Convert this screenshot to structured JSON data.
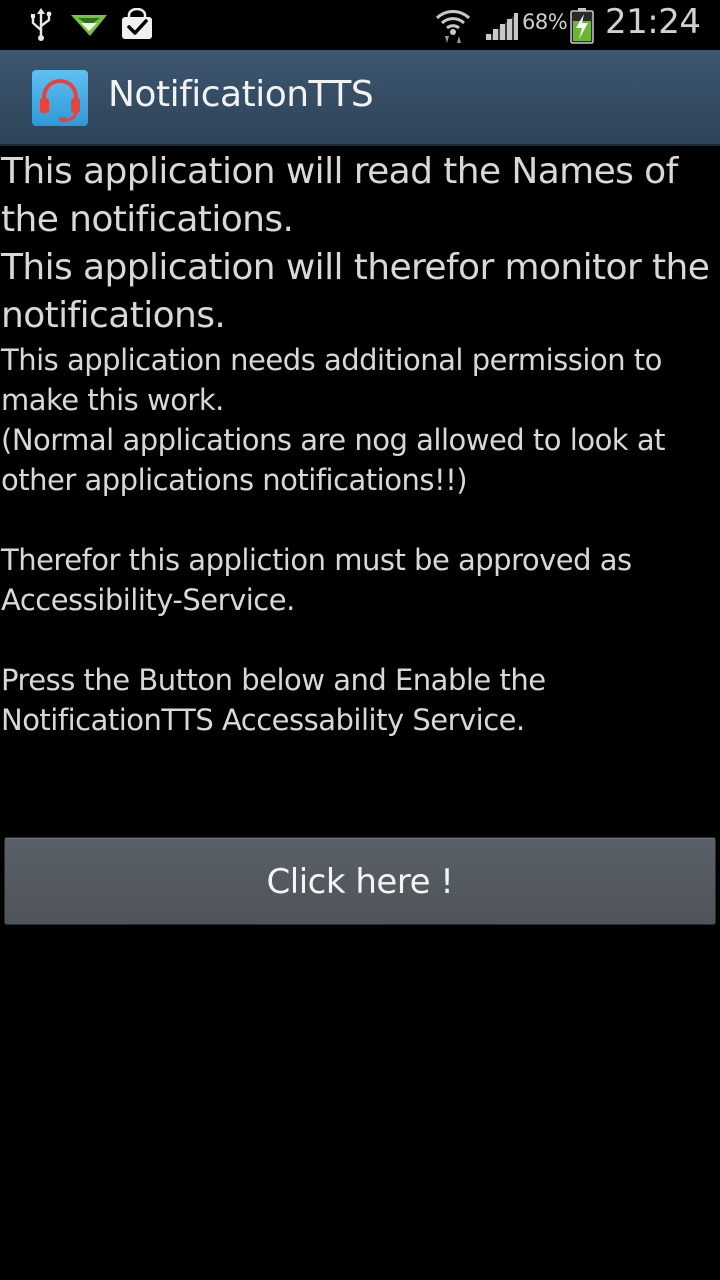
{
  "status_bar": {
    "battery_percent": "68%",
    "clock": "21:24",
    "icons": [
      "usb-icon",
      "airdroid-icon",
      "play-store-update-icon",
      "wifi-icon",
      "signal-icon",
      "battery-charging-icon"
    ]
  },
  "action_bar": {
    "title": "NotificationTTS",
    "icon": "headset-icon"
  },
  "content": {
    "line1": "This application will read the Names of the notifications.",
    "line2": "This application will therefor monitor the notifications.",
    "para1": "This application needs additional permission to make this work.\n(Normal applications are nog allowed to look at other applications notifications!!)",
    "para2": "Therefor this appliction must be approved as Accessibility-Service.",
    "para3": "Press the Button below and Enable the NotificationTTS Accessability Service."
  },
  "button": {
    "label": "Click here !"
  },
  "colors": {
    "background": "#000000",
    "action_bar": "#34495e",
    "text": "#d8d8d8",
    "button": "#555b61"
  }
}
